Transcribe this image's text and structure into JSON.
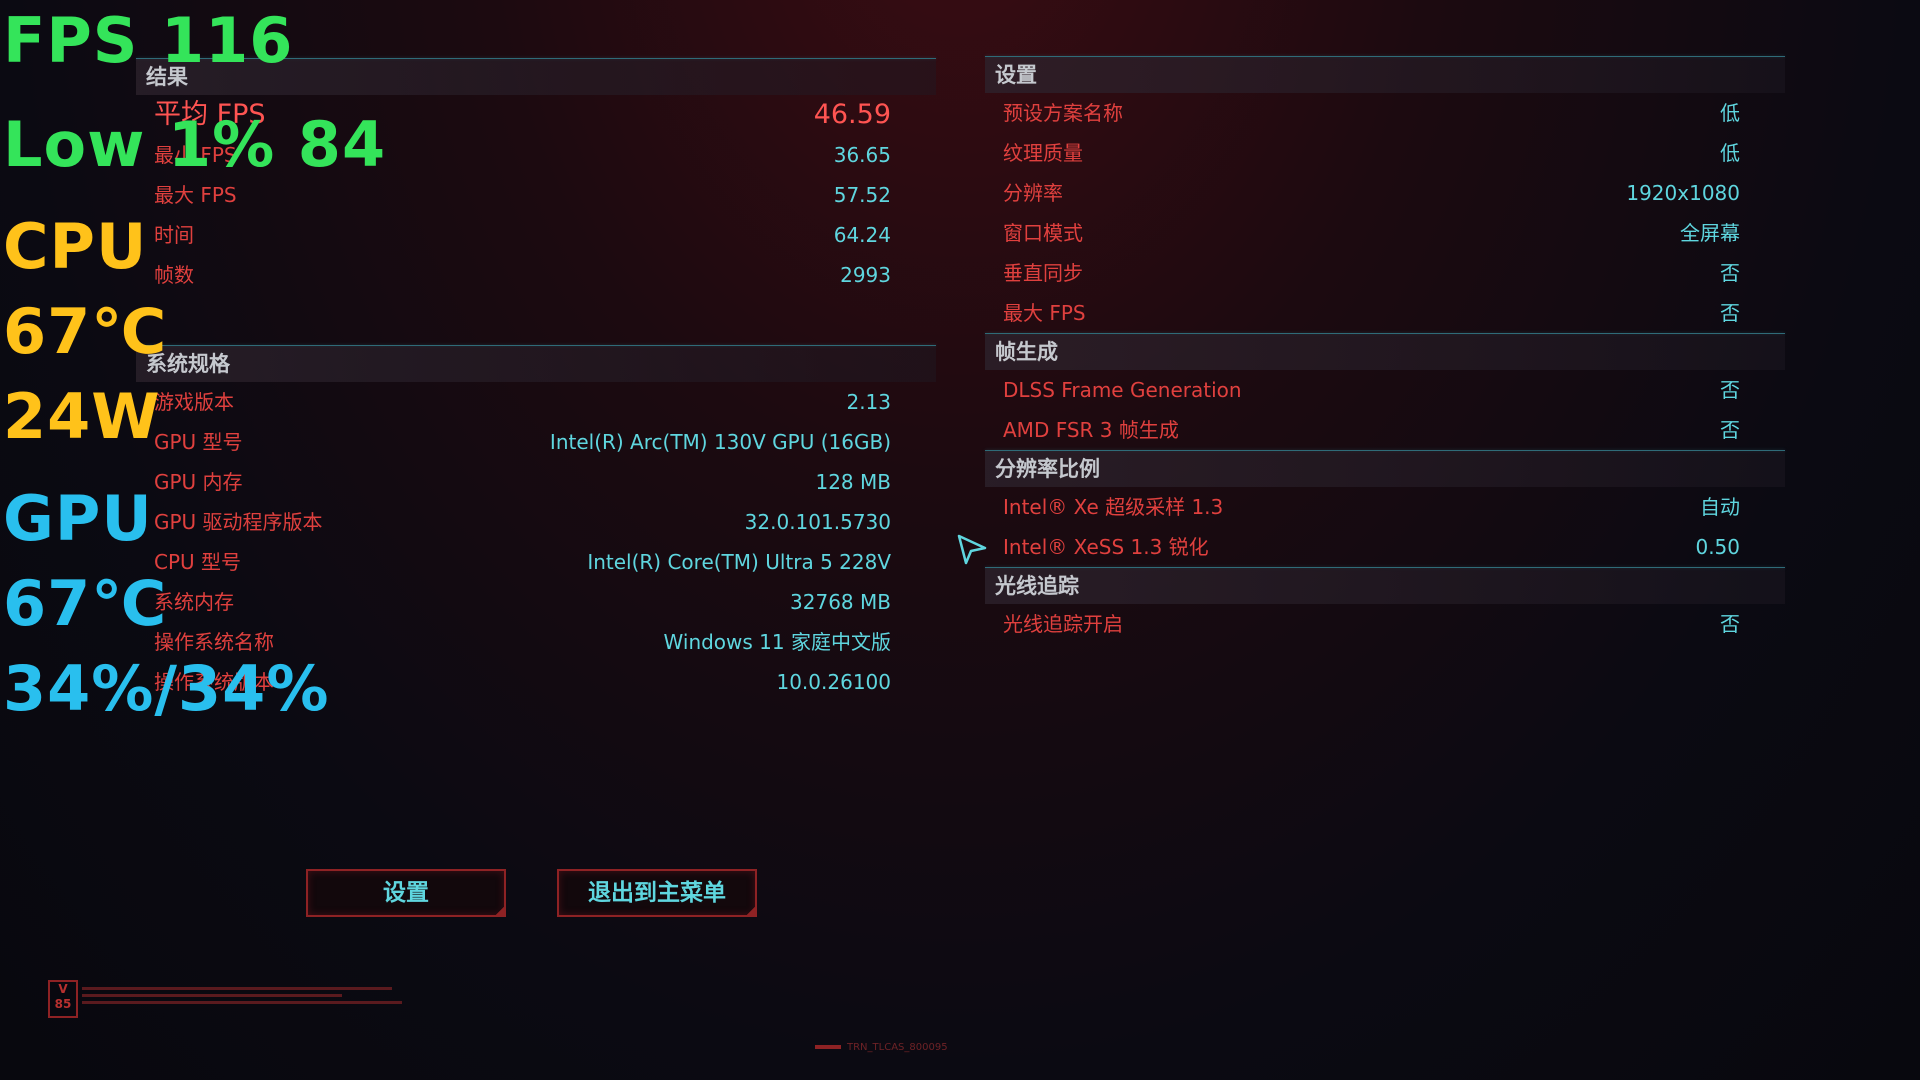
{
  "overlay": {
    "fps": "FPS  116",
    "low": "Low  1%  84",
    "cpu_label": "CPU",
    "cpu_temp": "67℃",
    "cpu_power": "24W",
    "gpu_label": "GPU",
    "gpu_temp": "67℃",
    "gpu_usage": "34%/34%",
    "colors": {
      "fps": "#34e45a",
      "cpu": "#ffc21a",
      "gpu": "#29bfee"
    }
  },
  "results": {
    "header": "结果",
    "rows": [
      {
        "label": "平均 FPS",
        "value": "46.59"
      },
      {
        "label": "最小 FPS",
        "value": "36.65"
      },
      {
        "label": "最大 FPS",
        "value": "57.52"
      },
      {
        "label": "时间",
        "value": "64.24"
      },
      {
        "label": "帧数",
        "value": "2993"
      }
    ]
  },
  "specs": {
    "header": "系统规格",
    "rows": [
      {
        "label": "游戏版本",
        "value": "2.13"
      },
      {
        "label": "GPU 型号",
        "value": "Intel(R) Arc(TM) 130V GPU (16GB)"
      },
      {
        "label": "GPU 内存",
        "value": "128 MB"
      },
      {
        "label": "GPU 驱动程序版本",
        "value": "32.0.101.5730"
      },
      {
        "label": "CPU 型号",
        "value": "Intel(R) Core(TM) Ultra 5 228V"
      },
      {
        "label": "系统内存",
        "value": "32768 MB"
      },
      {
        "label": "操作系统名称",
        "value": "Windows 11 家庭中文版"
      },
      {
        "label": "操作系统版本",
        "value": "10.0.26100"
      }
    ]
  },
  "settings": {
    "header": "设置",
    "rows": [
      {
        "label": "预设方案名称",
        "value": "低"
      },
      {
        "label": "纹理质量",
        "value": "低"
      },
      {
        "label": "分辨率",
        "value": "1920x1080"
      },
      {
        "label": "窗口模式",
        "value": "全屏幕"
      },
      {
        "label": "垂直同步",
        "value": "否"
      },
      {
        "label": "最大 FPS",
        "value": "否"
      }
    ]
  },
  "framegen": {
    "header": "帧生成",
    "rows": [
      {
        "label": "DLSS Frame Generation",
        "value": "否"
      },
      {
        "label": "AMD FSR 3 帧生成",
        "value": "否"
      }
    ]
  },
  "scaling": {
    "header": "分辨率比例",
    "rows": [
      {
        "label": "Intel® Xe 超级采样 1.3",
        "value": "自动"
      },
      {
        "label": "Intel® XeSS 1.3 锐化",
        "value": "0.50"
      }
    ]
  },
  "raytracing": {
    "header": "光线追踪",
    "rows": [
      {
        "label": "光线追踪开启",
        "value": "否"
      }
    ]
  },
  "buttons": {
    "settings": "设置",
    "exit": "退出到主菜单"
  },
  "footer": {
    "logo": "V 85",
    "build_tag": "TRN_TLCAS_800095"
  },
  "icons": {
    "cursor": "pointer-cursor-icon",
    "logo": "v85-logo-icon"
  },
  "colors": {
    "label_red": "#e0403e",
    "value_cyan": "#5fd6df",
    "header_gray": "#c5c8ce",
    "divider_teal": "#2f6b78",
    "button_border": "#8e2224"
  }
}
